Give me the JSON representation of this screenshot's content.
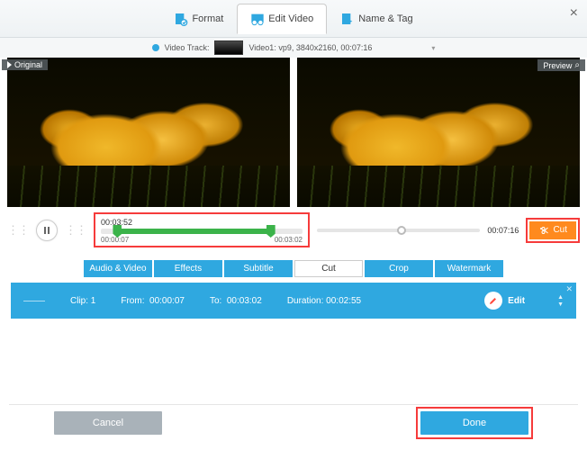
{
  "tabs": {
    "format": "Format",
    "edit": "Edit Video",
    "nametag": "Name & Tag"
  },
  "track": {
    "label": "Video Track:",
    "info": "Video1: vp9, 3840x2160, 00:07:16"
  },
  "badges": {
    "original": "Original",
    "preview": "Preview"
  },
  "timeline": {
    "current": "00:03:52",
    "start": "00:00:07",
    "end": "00:03:02",
    "total": "00:07:16"
  },
  "cutButton": "Cut",
  "subtabs": {
    "av": "Audio & Video",
    "effects": "Effects",
    "subtitle": "Subtitle",
    "cut": "Cut",
    "crop": "Crop",
    "watermark": "Watermark"
  },
  "clip": {
    "index": "Clip: 1",
    "fromLabel": "From:",
    "from": "00:00:07",
    "toLabel": "To:",
    "to": "00:03:02",
    "durLabel": "Duration:",
    "dur": "00:02:55",
    "edit": "Edit"
  },
  "buttons": {
    "cancel": "Cancel",
    "done": "Done"
  }
}
